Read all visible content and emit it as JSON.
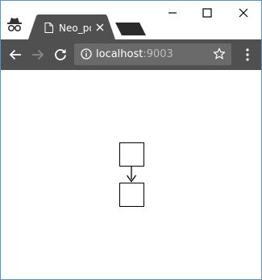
{
  "browser": {
    "tab": {
      "title": "Neo_po",
      "title_color": "#ffffff",
      "background": "#505050"
    },
    "address_bar": {
      "host": "localhost",
      "port": ":9003"
    },
    "icons": {
      "incognito": "incognito-icon",
      "tab_page": "page-icon",
      "tab_close": "close-icon",
      "new_tab": "new-tab-icon",
      "minimize": "minimize-icon",
      "maximize": "maximize-icon",
      "close": "close-icon",
      "back": "back-arrow-icon",
      "forward": "forward-arrow-icon",
      "reload": "reload-icon",
      "info": "info-icon",
      "bookmark": "star-icon",
      "menu": "more-vertical-icon"
    },
    "colors": {
      "toolbar": "#505050",
      "omnibox": "#6a6a6a",
      "window_border": "#5a8fd0"
    }
  },
  "page": {
    "diagram": {
      "nodes": [
        "",
        ""
      ],
      "edge": "arrow from top node to bottom node"
    }
  }
}
